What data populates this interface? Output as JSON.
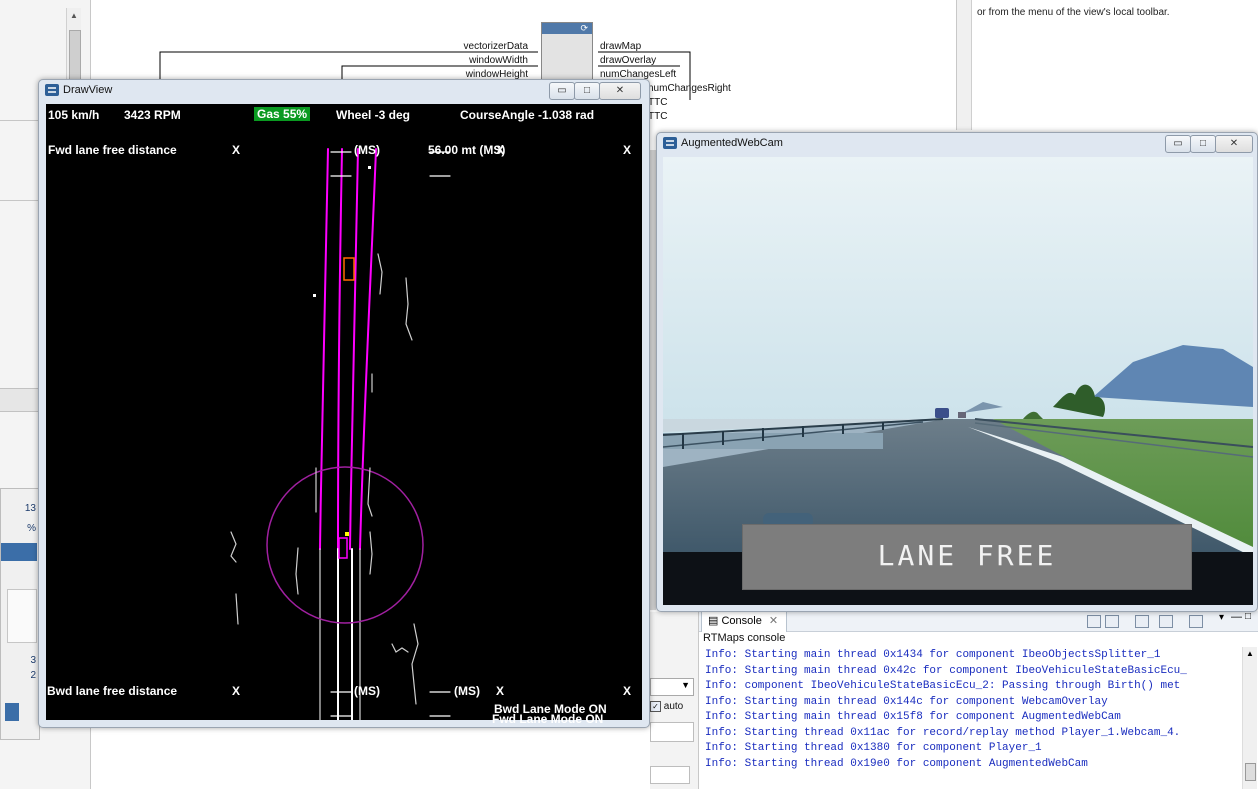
{
  "background_app": {
    "help_text": "or from the menu of the view's local toolbar.",
    "mini_panel": {
      "line1": "13",
      "line2": "%",
      "line3": "3",
      "line4": "2"
    },
    "diagram": {
      "inputs": [
        "vectorizerData",
        "windowWidth",
        "windowHeight"
      ],
      "outputs": [
        "drawMap",
        "drawOverlay",
        "numChangesLeft",
        "numChangesRight",
        "TTC",
        "TTC"
      ],
      "block_icon": "refresh-icon"
    }
  },
  "drawview": {
    "title": "DrawView",
    "speed": "105 km/h",
    "rpm": "3423 RPM",
    "gas": "Gas  55%",
    "wheel": "Wheel  -3 deg",
    "course_angle": "CourseAngle -1.038 rad",
    "fwd_label": "Fwd lane free distance",
    "bwd_label": "Bwd lane free distance",
    "fwd_ms_1": "(MS)",
    "fwd_ms_2": "56.00 mt (MS)",
    "bwd_ms_1": "(MS)",
    "bwd_ms_2": "(MS)",
    "x_mark": "X",
    "fwd_mode": "Fwd Lane Mode ON",
    "bwd_mode": "Bwd Lane Mode ON",
    "colors": {
      "lane": "#ff00ff",
      "circle": "#a020a0",
      "gas_bg": "#0a9a21",
      "target": "#ff6a00"
    }
  },
  "webcam": {
    "title": "AugmentedWebCam",
    "banner": "LANE FREE"
  },
  "console": {
    "tab": "Console",
    "subtitle": "RTMaps console",
    "lines": [
      "Info: Starting main thread 0x1434 for component IbeoObjectsSplitter_1",
      "Info: Starting main thread 0x42c for component IbeoVehiculeStateBasicEcu_",
      "Info: component IbeoVehiculeStateBasicEcu_2: Passing through Birth() met",
      "Info: Starting main thread 0x144c for component WebcamOverlay",
      "Info: Starting main thread 0x15f8 for component AugmentedWebCam",
      "Info: Starting thread 0x11ac for record/replay method Player_1.Webcam_4.",
      "Info: Starting thread 0x1380 for component Player_1",
      "Info: Starting thread 0x19e0 for component AugmentedWebCam"
    ]
  },
  "side_widget": {
    "auto_label": "auto"
  },
  "window_controls": {
    "minimize": "▭",
    "maximize": "□",
    "close": "✕"
  }
}
